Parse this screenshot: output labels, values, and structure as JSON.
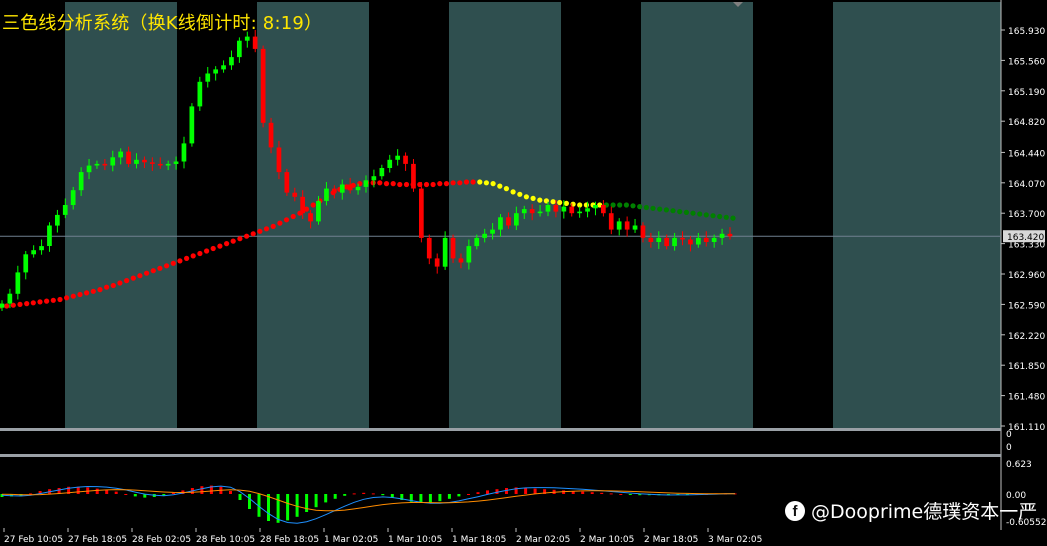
{
  "header": {
    "title": "三色线分析系统（换K线倒计时: 8:19）"
  },
  "watermark": {
    "icon": "facebook-icon",
    "text": "@Dooprime德璞资本一严"
  },
  "colors": {
    "background": "#000000",
    "band": "#2f4f4f",
    "grid_frame": "#c0c0c0",
    "bull": "#00ff00",
    "bear": "#ff0000",
    "dot_red": "#ff0000",
    "dot_yellow": "#ffff00",
    "dot_green": "#008000",
    "current_price_line": "#708090",
    "macd_line": "#1e90ff",
    "signal_line": "#ff8c00",
    "axis_text": "#ffffff"
  },
  "chart_data": {
    "type": "candlestick",
    "current_price": "163.420",
    "price_axis_labels": [
      "165.930",
      "165.560",
      "165.190",
      "164.820",
      "164.440",
      "164.070",
      "163.700",
      "163.330",
      "162.960",
      "162.590",
      "162.220",
      "161.850",
      "161.480",
      "161.110"
    ],
    "price_axis_values": [
      165.93,
      165.56,
      165.19,
      164.82,
      164.44,
      164.07,
      163.7,
      163.33,
      162.96,
      162.59,
      162.22,
      161.85,
      161.48,
      161.11
    ],
    "ylim": [
      161.11,
      165.93
    ],
    "time_axis_labels": [
      "27 Feb 10:05",
      "27 Feb 18:05",
      "28 Feb 02:05",
      "28 Feb 10:05",
      "28 Feb 18:05",
      "1 Mar 02:05",
      "1 Mar 10:05",
      "1 Mar 18:05",
      "2 Mar 02:05",
      "2 Mar 10:05",
      "2 Mar 18:05",
      "3 Mar 02:05"
    ],
    "session_bands": [
      "black",
      "slate",
      "black",
      "slate",
      "black",
      "slate",
      "black",
      "slate",
      "black",
      "slate",
      "black",
      "slate"
    ],
    "closes": [
      162.6,
      162.72,
      162.98,
      163.2,
      163.25,
      163.3,
      163.55,
      163.68,
      163.8,
      163.98,
      164.2,
      164.28,
      164.3,
      164.28,
      164.38,
      164.45,
      164.3,
      164.35,
      164.32,
      164.3,
      164.28,
      164.3,
      164.33,
      164.55,
      165.0,
      165.3,
      165.4,
      165.45,
      165.5,
      165.6,
      165.8,
      165.85,
      165.7,
      164.8,
      164.5,
      164.2,
      163.95,
      163.9,
      163.7,
      163.6,
      163.85,
      164.0,
      163.95,
      164.05,
      163.98,
      164.02,
      164.1,
      164.15,
      164.25,
      164.35,
      164.4,
      164.3,
      164.0,
      163.4,
      163.15,
      163.05,
      163.4,
      163.15,
      163.1,
      163.3,
      163.4,
      163.45,
      163.5,
      163.65,
      163.55,
      163.7,
      163.75,
      163.7,
      163.72,
      163.8,
      163.72,
      163.78,
      163.7,
      163.72,
      163.76,
      163.8,
      163.7,
      163.5,
      163.6,
      163.5,
      163.55,
      163.4,
      163.35,
      163.4,
      163.3,
      163.4,
      163.38,
      163.32,
      163.4,
      163.35,
      163.4,
      163.45,
      163.42
    ],
    "ma_dots": [
      162.57,
      162.57,
      162.58,
      162.59,
      162.6,
      162.61,
      162.62,
      162.63,
      162.64,
      162.65,
      162.67,
      162.69,
      162.71,
      162.73,
      162.75,
      162.77,
      162.8,
      162.82,
      162.85,
      162.88,
      162.91,
      162.94,
      162.97,
      163.0,
      163.03,
      163.06,
      163.09,
      163.12,
      163.15,
      163.18,
      163.21,
      163.24,
      163.27,
      163.3,
      163.33,
      163.36,
      163.39,
      163.42,
      163.45,
      163.48,
      163.51,
      163.54,
      163.58,
      163.62,
      163.66,
      163.7,
      163.75,
      163.8,
      163.85,
      163.9,
      163.95,
      163.99,
      164.02,
      164.04,
      164.06,
      164.07,
      164.07,
      164.07,
      164.06,
      164.06,
      164.05,
      164.05,
      164.05,
      164.05,
      164.05,
      164.05,
      164.06,
      164.06,
      164.07,
      164.07,
      164.08,
      164.08,
      164.08,
      164.07,
      164.06,
      164.03,
      164.0,
      163.96,
      163.93,
      163.9,
      163.88,
      163.86,
      163.85,
      163.84,
      163.83,
      163.82,
      163.81,
      163.8,
      163.8,
      163.8,
      163.8,
      163.8,
      163.8,
      163.8,
      163.8,
      163.79,
      163.78,
      163.77,
      163.76,
      163.75,
      163.74,
      163.73,
      163.72,
      163.71,
      163.7,
      163.69,
      163.68,
      163.67,
      163.66,
      163.65,
      163.64
    ],
    "ma_color_segments": [
      {
        "from": 0,
        "to": 71,
        "color": "red"
      },
      {
        "from": 72,
        "to": 90,
        "color": "yellow"
      },
      {
        "from": 91,
        "to": 111,
        "color": "green"
      }
    ],
    "sub1_labels": [
      "0",
      "0"
    ],
    "sub2_labels": [
      "0.623",
      "0.00",
      "-0.60552"
    ],
    "macd_histogram": [
      -0.05,
      -0.04,
      -0.03,
      0.01,
      0.05,
      0.08,
      0.1,
      0.12,
      0.12,
      0.11,
      0.09,
      0.07,
      0.04,
      0.0,
      -0.04,
      -0.06,
      -0.05,
      -0.03,
      0.02,
      0.06,
      0.1,
      0.13,
      0.14,
      0.12,
      0.05,
      -0.1,
      -0.25,
      -0.38,
      -0.45,
      -0.48,
      -0.44,
      -0.38,
      -0.3,
      -0.22,
      -0.14,
      -0.08,
      -0.03,
      0.01,
      0.02,
      0.01,
      -0.02,
      -0.06,
      -0.1,
      -0.13,
      -0.15,
      -0.14,
      -0.12,
      -0.08,
      -0.04,
      0.0,
      0.03,
      0.06,
      0.08,
      0.1,
      0.11,
      0.1,
      0.09,
      0.08,
      0.07,
      0.06,
      0.05,
      0.04,
      0.03,
      0.02,
      0.01,
      0.0,
      -0.01,
      -0.02,
      -0.02,
      -0.02,
      -0.02,
      -0.01,
      -0.01,
      0.0,
      0.0,
      0.01,
      0.01,
      0.01
    ]
  }
}
